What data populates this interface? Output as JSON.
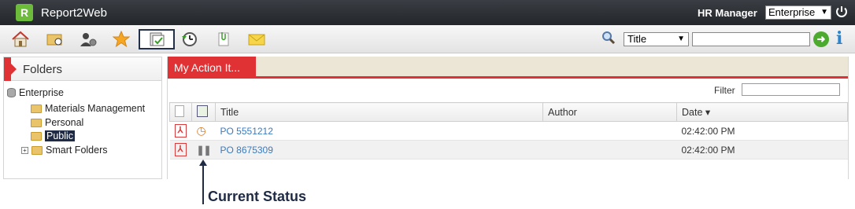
{
  "app": {
    "title": "Report2Web",
    "logo_glyph": "R"
  },
  "header": {
    "user": "HR Manager",
    "org_select": "Enterprise"
  },
  "toolbar": {
    "field_select": "Title",
    "search_value": ""
  },
  "folders": {
    "title": "Folders",
    "items": [
      "Enterprise",
      "Materials Management",
      "Personal",
      "Public",
      "Smart Folders"
    ]
  },
  "tab": {
    "label": "My Action It..."
  },
  "filter": {
    "label": "Filter",
    "value": ""
  },
  "table": {
    "columns": [
      "Title",
      "Author",
      "Date ▾"
    ],
    "rows": [
      {
        "title": "PO 5551212",
        "author": "",
        "date": "02:42:00 PM",
        "status": "clock"
      },
      {
        "title": "PO 8675309",
        "author": "",
        "date": "02:42:00 PM",
        "status": "paused"
      }
    ]
  },
  "annotation": {
    "label": "Current Status"
  },
  "colors": {
    "accent": "#e03234",
    "header_bg": "#2b2f33",
    "link": "#3a7bbf"
  }
}
